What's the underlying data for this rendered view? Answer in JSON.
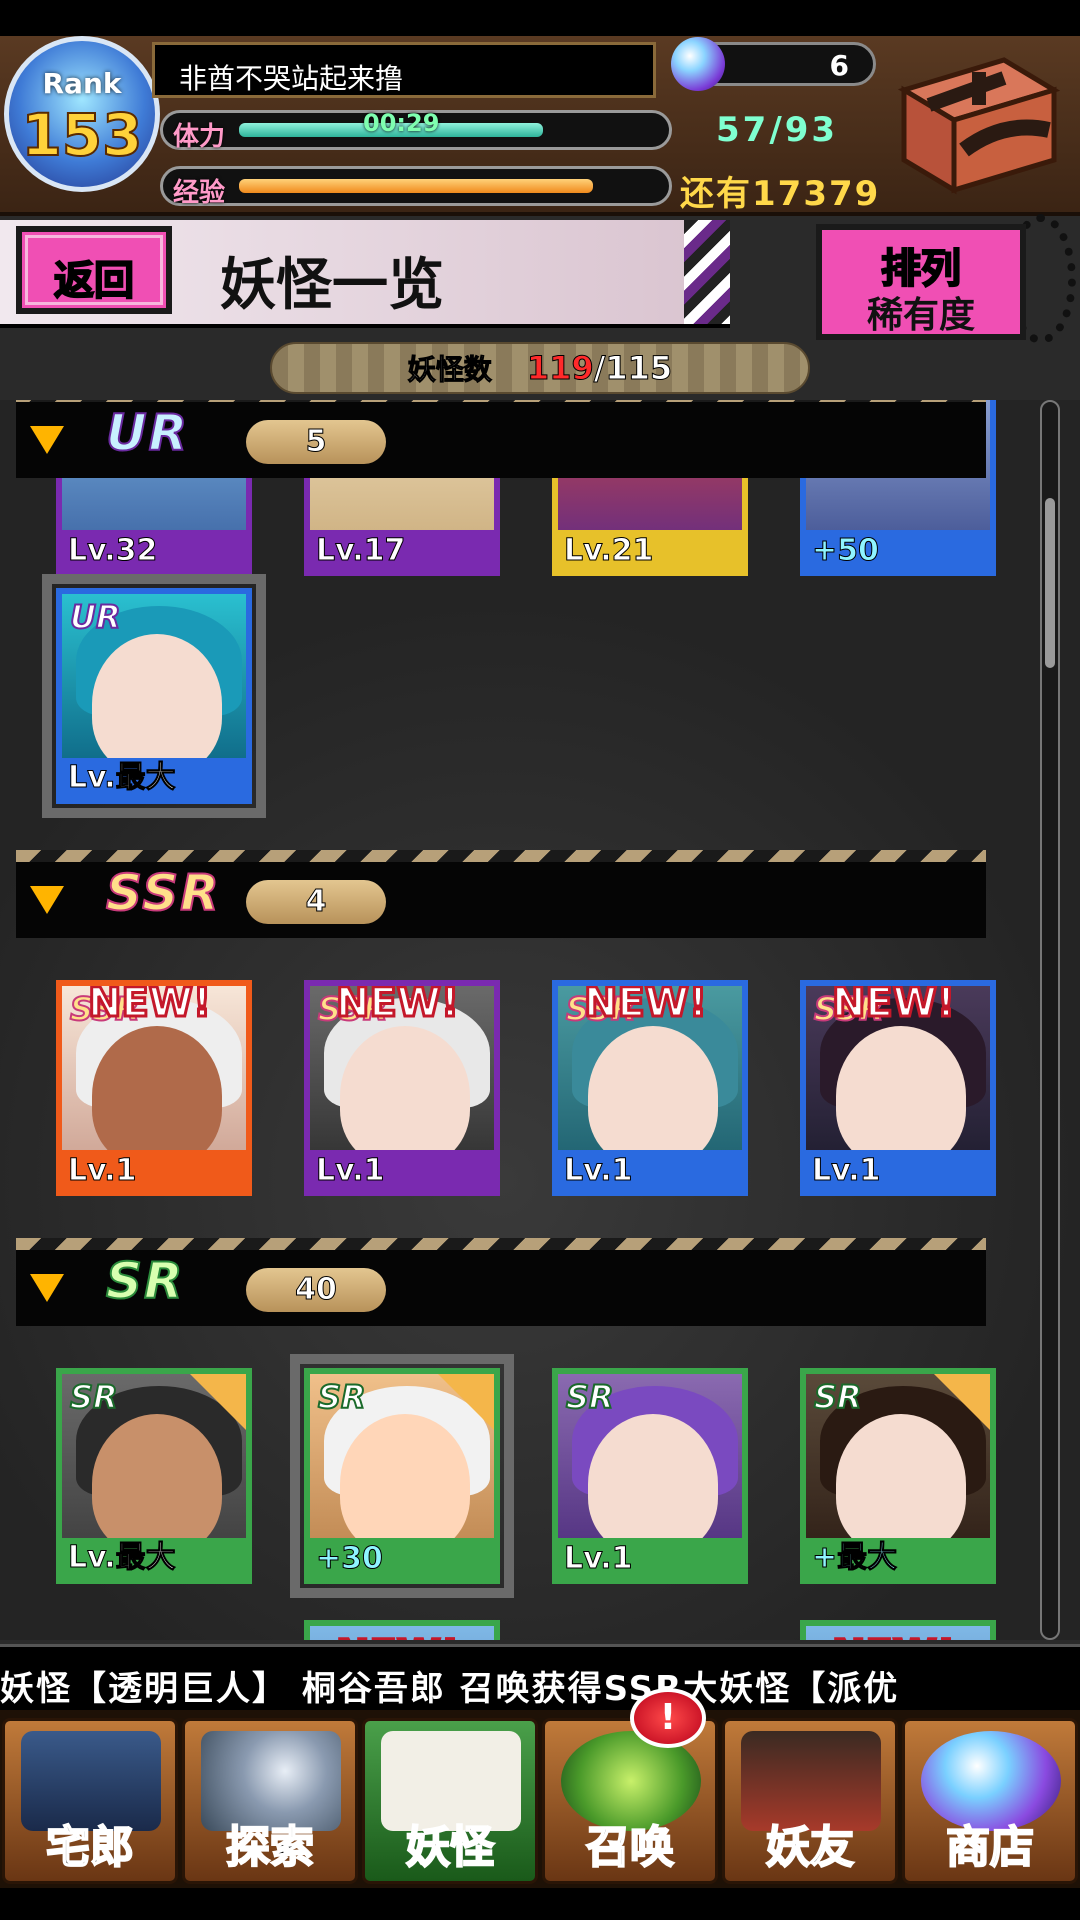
{
  "header": {
    "rank_label": "Rank",
    "rank_value": "153",
    "player_name": "非酋不哭站起来撸",
    "gems": "6",
    "stamina_label": "体力",
    "stamina_timer": "00:29",
    "stamina_value": "57/93",
    "stamina_ratio": 0.6,
    "exp_label": "经验",
    "exp_remaining": "还有17379",
    "exp_ratio": 0.7
  },
  "titlebar": {
    "back_label": "返回",
    "title": "妖怪一览",
    "sort_line1": "排列",
    "sort_line2": "稀有度"
  },
  "count": {
    "label": "妖怪数",
    "current": "119",
    "total": "/115"
  },
  "sections": [
    {
      "rarity": "UR",
      "count": "5",
      "cards": [
        {
          "level": "Lv.32",
          "color": "#7a2ab0"
        },
        {
          "level": "Lv.17",
          "color": "#7a2ab0"
        },
        {
          "level": "Lv.21",
          "color": "#e7c12a"
        },
        {
          "level": "+50",
          "color": "#2a6ae0"
        },
        {
          "level": "Lv.最大",
          "color": "#2a6ae0",
          "badge": "UR"
        }
      ]
    },
    {
      "rarity": "SSR",
      "count": "4",
      "cards": [
        {
          "level": "Lv.1",
          "color": "#f05a1a",
          "badge": "SSR",
          "new": "NEW!"
        },
        {
          "level": "Lv.1",
          "color": "#7a2ab0",
          "badge": "SSR",
          "new": "NEW!"
        },
        {
          "level": "Lv.1",
          "color": "#2a6ae0",
          "badge": "SSR",
          "new": "NEW!"
        },
        {
          "level": "Lv.1",
          "color": "#2a6ae0",
          "badge": "SSR",
          "new": "NEW!"
        }
      ]
    },
    {
      "rarity": "SR",
      "count": "40",
      "cards": [
        {
          "level": "Lv.最大",
          "color": "#3aa64a",
          "badge": "SR"
        },
        {
          "level": "+30",
          "color": "#3aa64a",
          "badge": "SR"
        },
        {
          "level": "Lv.1",
          "color": "#3aa64a",
          "badge": "SR"
        },
        {
          "level": "+最大",
          "color": "#3aa64a",
          "badge": "SR"
        }
      ]
    }
  ],
  "partial_row": {
    "new_a": "NEW!",
    "new_b": "NEW!"
  },
  "ticker": "妖怪【透明巨人】    桐谷吾郎 召唤获得SSR大妖怪【派优",
  "nav": [
    {
      "label": "宅郎",
      "icon": "house-icon"
    },
    {
      "label": "探索",
      "icon": "magnifier-map-icon"
    },
    {
      "label": "妖怪",
      "icon": "scroll-icon"
    },
    {
      "label": "召唤",
      "icon": "pentagram-icon"
    },
    {
      "label": "妖友",
      "icon": "catgirl-icon"
    },
    {
      "label": "商店",
      "icon": "crystal-orb-icon"
    }
  ],
  "summon_alert": "!"
}
